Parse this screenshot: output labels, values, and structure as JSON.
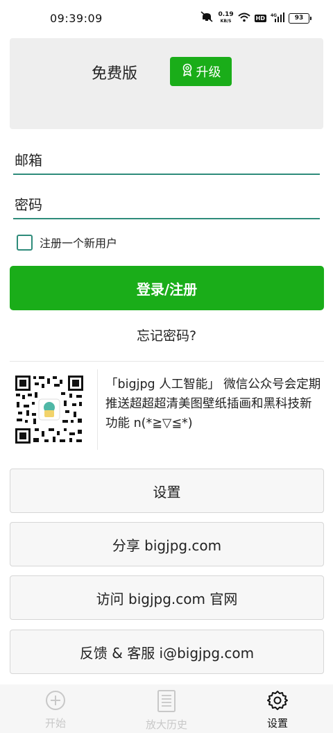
{
  "status_bar": {
    "time": "09:39:09",
    "net_speed": "0.19",
    "net_speed_unit": "KB/S",
    "hd_badge": "HD",
    "network_type": "4G",
    "battery": "93"
  },
  "plan": {
    "label": "免费版",
    "upgrade_label": "升级"
  },
  "form": {
    "email_placeholder": "邮箱",
    "password_placeholder": "密码",
    "register_label": "注册一个新用户",
    "login_label": "登录/注册",
    "forgot_label": "忘记密码?"
  },
  "promo": {
    "text": "「bigjpg 人工智能」 微信公众号会定期推送超超超清美图壁纸插画和黑科技新功能 n(*≧▽≦*)"
  },
  "menu": {
    "settings": "设置",
    "share": "分享 bigjpg.com",
    "visit": "访问 bigjpg.com 官网",
    "feedback": "反馈 & 客服 i@bigjpg.com"
  },
  "bottom_nav": {
    "items": [
      {
        "label": "开始",
        "icon": "plus-circle-icon"
      },
      {
        "label": "放大历史",
        "icon": "document-list-icon"
      },
      {
        "label": "设置",
        "icon": "gear-icon"
      }
    ],
    "active_index": 2
  },
  "colors": {
    "accent": "#1aad19",
    "field_underline": "#2e8b7a"
  }
}
